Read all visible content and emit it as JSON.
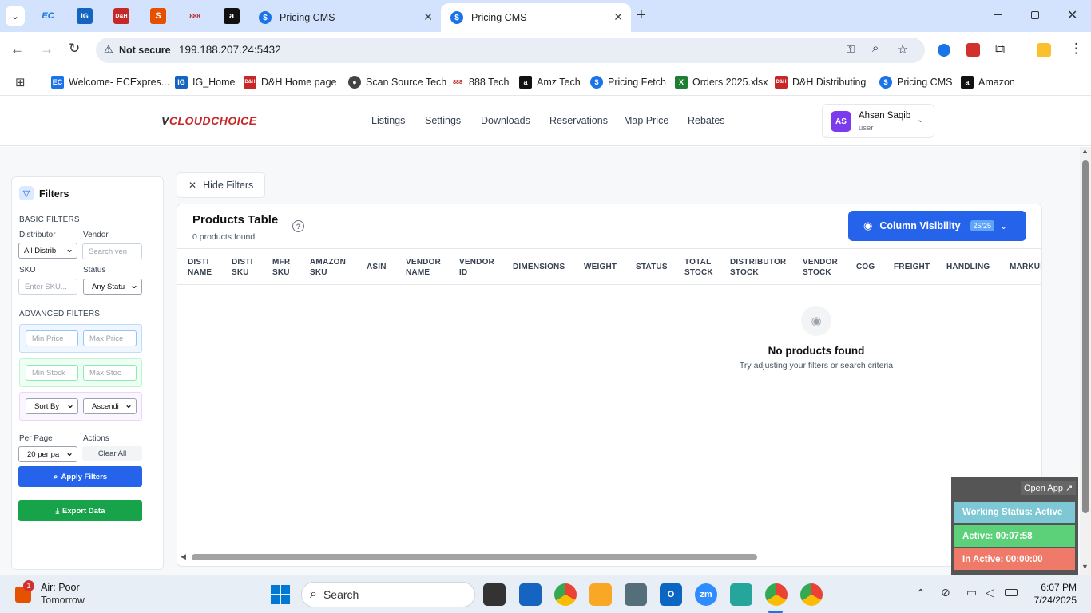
{
  "browser": {
    "tabs": [
      {
        "label": "Pricing CMS",
        "active": false
      },
      {
        "label": "Pricing CMS",
        "active": true
      }
    ],
    "pinned_icons": [
      "EC",
      "IG",
      "D&H",
      "S",
      "888",
      "a"
    ],
    "new_tab": "+",
    "security": "Not secure",
    "url": "199.188.207.24:5432",
    "bookmarks": [
      "Welcome- ECExpres...",
      "IG_Home",
      "D&H Home page",
      "Scan Source Tech",
      "888 Tech",
      "Amz Tech",
      "Pricing Fetch",
      "Orders 2025.xlsx",
      "D&H Distributing",
      "Pricing CMS",
      "Amazon"
    ]
  },
  "app": {
    "logo": "CLOUDCHOICE",
    "nav": [
      "Listings",
      "Settings",
      "Downloads",
      "Reservations",
      "Map Price",
      "Rebates"
    ],
    "user": {
      "initials": "AS",
      "name": "Ahsan Saqib",
      "role": "user"
    }
  },
  "filters": {
    "title": "Filters",
    "basic_label": "BASIC FILTERS",
    "distributor_label": "Distributor",
    "distributor_value": "All Distrib",
    "vendor_label": "Vendor",
    "vendor_placeholder": "Search ven",
    "sku_label": "SKU",
    "sku_placeholder": "Enter SKU...",
    "status_label": "Status",
    "status_value": "Any Statu",
    "advanced_label": "ADVANCED FILTERS",
    "min_price": "Min Price",
    "max_price": "Max Price",
    "min_stock": "Min Stock",
    "max_stock": "Max Stoc",
    "sort_by": "Sort By",
    "sort_order": "Ascendi",
    "per_page_label": "Per Page",
    "per_page_value": "20 per pa",
    "actions_label": "Actions",
    "clear_all": "Clear All",
    "apply": "Apply Filters",
    "export": "Export Data"
  },
  "hide_filters": "Hide Filters",
  "products": {
    "title": "Products Table",
    "count_text": "0 products found",
    "column_visibility": "Column Visibility",
    "column_count": "25/25",
    "columns": [
      [
        "DISTI",
        "NAME"
      ],
      [
        "DISTI",
        "SKU"
      ],
      [
        "MFR",
        "SKU"
      ],
      [
        "AMAZON",
        "SKU"
      ],
      [
        "ASIN",
        ""
      ],
      [
        "VENDOR",
        "NAME"
      ],
      [
        "VENDOR",
        "ID"
      ],
      [
        "DIMENSIONS",
        ""
      ],
      [
        "WEIGHT",
        ""
      ],
      [
        "STATUS",
        ""
      ],
      [
        "TOTAL",
        "STOCK"
      ],
      [
        "DISTRIBUTOR",
        "STOCK"
      ],
      [
        "VENDOR",
        "STOCK"
      ],
      [
        "COG",
        ""
      ],
      [
        "FREIGHT",
        ""
      ],
      [
        "HANDLING",
        ""
      ],
      [
        "MARKUP",
        ""
      ]
    ],
    "empty_title": "No products found",
    "empty_sub": "Try adjusting your filters or search criteria"
  },
  "widget": {
    "open_app": "Open App ↗",
    "working_status": "Working Status: Active",
    "active": "Active: 00:07:58",
    "inactive": "In Active: 00:00:00"
  },
  "taskbar": {
    "weather_badge": "1",
    "weather_title": "Air: Poor",
    "weather_sub": "Tomorrow",
    "search": "Search",
    "time": "6:07 PM",
    "date": "7/24/2025"
  }
}
